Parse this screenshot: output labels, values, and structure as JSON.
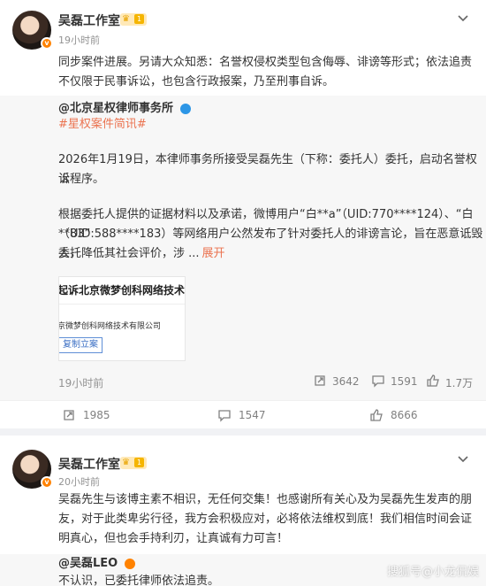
{
  "post1": {
    "author": "吴磊工作室",
    "level": "1",
    "time": "19小时前",
    "text_line1": "同步案件进展。另请大众知悉：名誉权侵权类型包含侮辱、诽谤等形式；依法追责",
    "text_line2": "不仅限于民事诉讼，也包含行政报案，乃至刑事自诉。",
    "repost": {
      "author": "@北京星权律师事务所",
      "hashtag": "#星权案件简讯#",
      "para1_line1": "2026年1月19日，本律师事务所接受吴磊先生（下称：委托人）委托，启动名誉权诉",
      "para1_line2": "讼程序。",
      "para2_line1": "根据委托人提供的证据材料以及承诺，微博用户“白**a”（UID:770****124）、“白**83”",
      "para2_line2": "（UID:588****183）等网络用户公然发布了针对委托人的诽谤言论，旨在恶意诋毁委托",
      "para2_line3": "人，降低其社会评价，涉 ...",
      "expand": "展开",
      "card_title": "起诉北京微梦创科网络技术有",
      "card_sub": "京微梦创科网络技术有限公司",
      "card_tag": "复制立案",
      "time": "19小时前",
      "reposts": "3642",
      "comments": "1591",
      "likes": "1.7万"
    },
    "reposts": "1985",
    "comments": "1547",
    "likes": "8666"
  },
  "post2": {
    "author": "吴磊工作室",
    "level": "1",
    "time": "20小时前",
    "text_line1": "吴磊先生与该博主素不相识，无任何交集！也感谢所有关心及为吴磊先生发声的朋",
    "text_line2": "友，对于此类卑劣行径，我方会积极应对，必将依法维权到底！我们相信时间会证",
    "text_line3": "明真心，但也会手持利刃，让真诚有力可言！",
    "repost_author": "@吴磊LEO",
    "repost_text": "不认识，已委托律师依法追责。"
  },
  "watermark": "搜狐号@小龙侃娱"
}
